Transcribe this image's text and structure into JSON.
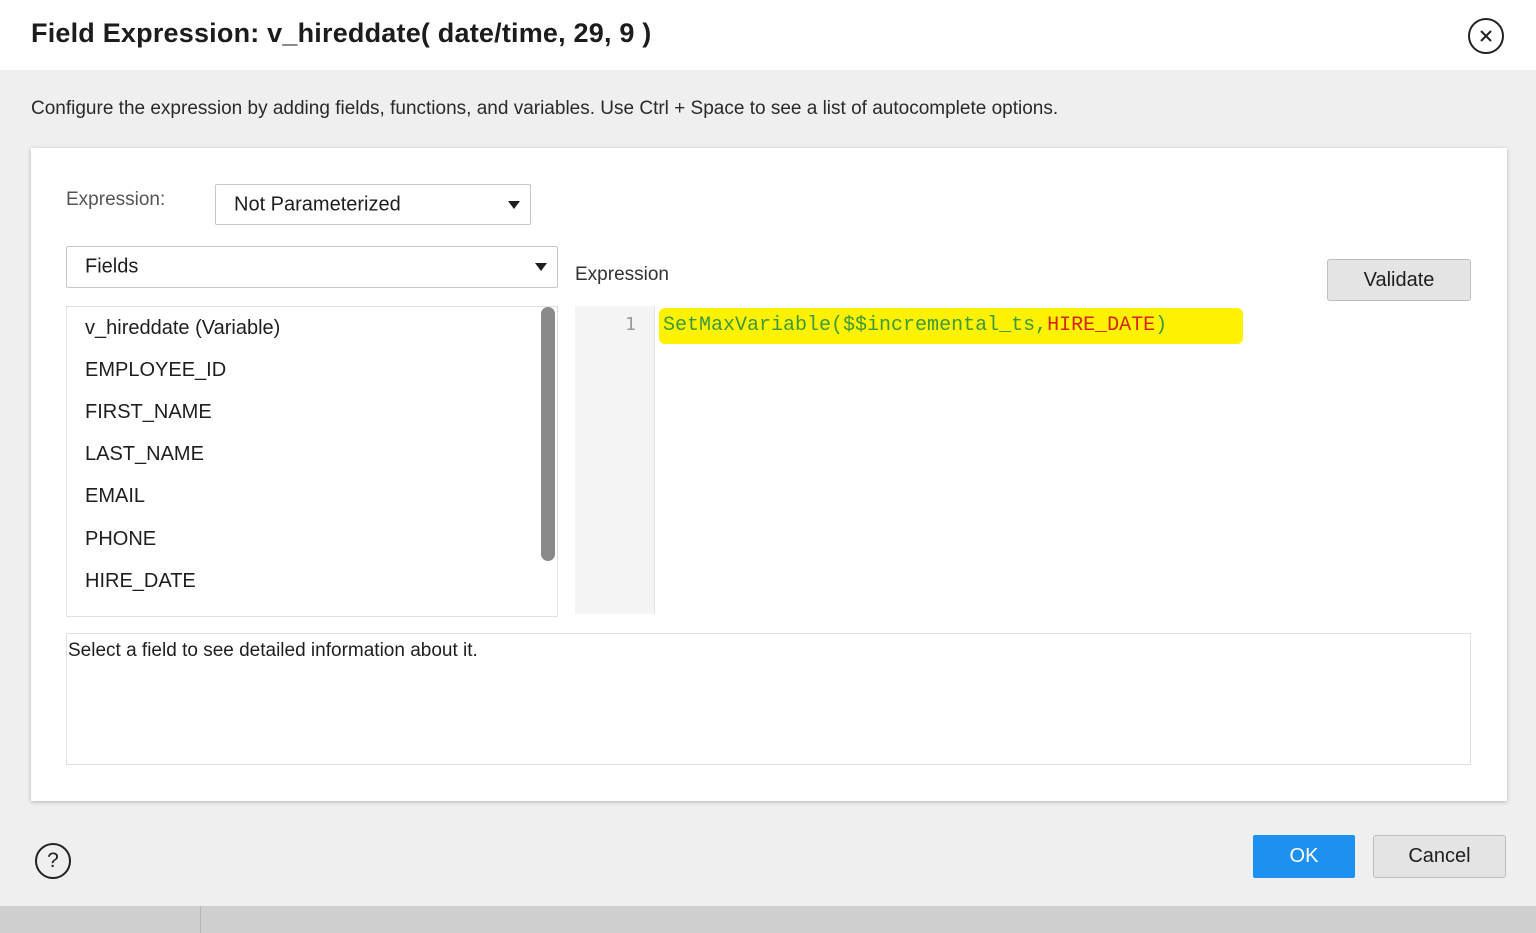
{
  "dialog": {
    "title": "Field Expression: v_hireddate( date/time, 29, 9 )",
    "subtitle": "Configure the expression by adding fields, functions, and variables. Use Ctrl + Space to see a list of autocomplete options."
  },
  "expression_param": {
    "label": "Expression:",
    "selected": "Not Parameterized"
  },
  "fields_dropdown": {
    "selected": "Fields"
  },
  "fields_list": {
    "items": [
      "v_hireddate (Variable)",
      "EMPLOYEE_ID",
      "FIRST_NAME",
      "LAST_NAME",
      "EMAIL",
      "PHONE",
      "HIRE_DATE"
    ]
  },
  "editor": {
    "title": "Expression",
    "validate_label": "Validate",
    "line_number": "1",
    "tokens": {
      "fn": "SetMaxVariable",
      "open": "(",
      "var": "$$incremental_ts",
      "comma": ",",
      "field": "HIRE_DATE",
      "close": ")"
    }
  },
  "info": {
    "text": "Select a field to see detailed information about it."
  },
  "footer": {
    "help_glyph": "?",
    "ok_label": "OK",
    "cancel_label": "Cancel"
  },
  "colors": {
    "ok_button": "#1e90f0",
    "code_highlight": "#fff200",
    "function_token": "#3c9a3c",
    "field_token": "#d8231b"
  }
}
